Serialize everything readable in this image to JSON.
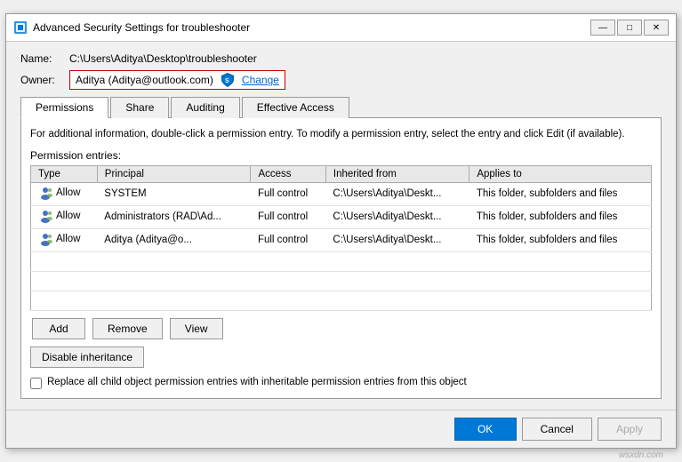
{
  "window": {
    "title": "Advanced Security Settings for troubleshooter",
    "minimize_label": "—",
    "maximize_label": "□",
    "close_label": "✕"
  },
  "fields": {
    "name_label": "Name:",
    "name_value": "C:\\Users\\Aditya\\Desktop\\troubleshooter",
    "owner_label": "Owner:",
    "owner_value": "Aditya (Aditya@outlook.com)",
    "change_label": "Change"
  },
  "tabs": [
    {
      "id": "permissions",
      "label": "Permissions",
      "active": true
    },
    {
      "id": "share",
      "label": "Share",
      "active": false
    },
    {
      "id": "auditing",
      "label": "Auditing",
      "active": false
    },
    {
      "id": "effective-access",
      "label": "Effective Access",
      "active": false
    }
  ],
  "info_text": "For additional information, double-click a permission entry. To modify a permission entry, select the entry and click Edit (if available).",
  "entries_label": "Permission entries:",
  "table": {
    "headers": [
      "Type",
      "Principal",
      "Access",
      "Inherited from",
      "Applies to"
    ],
    "rows": [
      {
        "type": "Allow",
        "principal": "SYSTEM",
        "access": "Full control",
        "inherited_from": "C:\\Users\\Aditya\\Deskt...",
        "applies_to": "This folder, subfolders and files"
      },
      {
        "type": "Allow",
        "principal": "Administrators (RAD\\Ad...",
        "access": "Full control",
        "inherited_from": "C:\\Users\\Aditya\\Deskt...",
        "applies_to": "This folder, subfolders and files"
      },
      {
        "type": "Allow",
        "principal": "Aditya (Aditya@o...",
        "access": "Full control",
        "inherited_from": "C:\\Users\\Aditya\\Deskt...",
        "applies_to": "This folder, subfolders and files"
      }
    ]
  },
  "buttons": {
    "add": "Add",
    "remove": "Remove",
    "view": "View",
    "disable_inheritance": "Disable inheritance"
  },
  "checkbox": {
    "label": "Replace all child object permission entries with inheritable permission entries from this object"
  },
  "footer": {
    "ok": "OK",
    "cancel": "Cancel",
    "apply": "Apply"
  },
  "watermark": "wsxdn.com"
}
